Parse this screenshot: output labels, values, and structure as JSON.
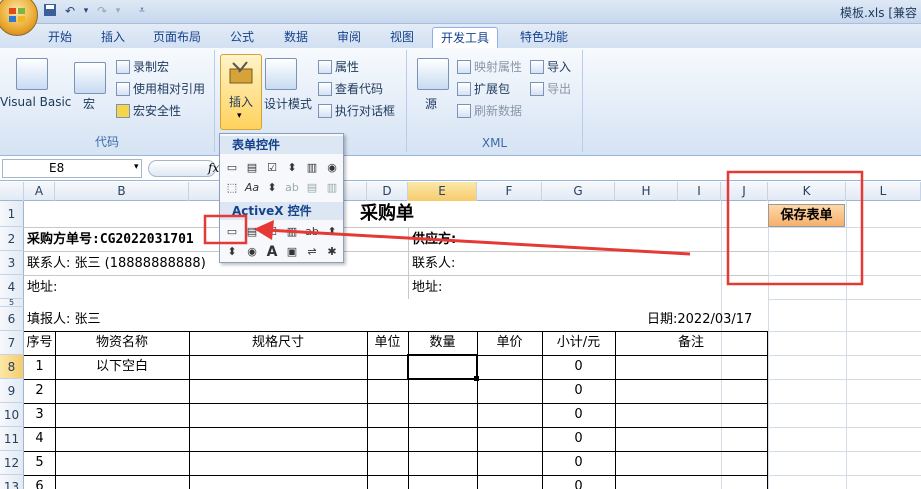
{
  "title_bar": {
    "doc_title": "模板.xls  [兼容"
  },
  "tabs": [
    "开始",
    "插入",
    "页面布局",
    "公式",
    "数据",
    "审阅",
    "视图",
    "开发工具",
    "特色功能"
  ],
  "active_tab": "开发工具",
  "ribbon": {
    "code_group": {
      "label": "代码",
      "visual_basic": "Visual Basic",
      "macro": "宏",
      "record_macro": "录制宏",
      "relative_ref": "使用相对引用",
      "macro_security": "宏安全性"
    },
    "controls_group": {
      "insert": "插入",
      "design_mode": "设计模式",
      "properties": "属性",
      "view_code": "查看代码",
      "run_dialog": "执行对话框"
    },
    "xml_group": {
      "label": "XML",
      "source": "源",
      "map_props": "映射属性",
      "expansion": "扩展包",
      "refresh": "刷新数据",
      "import": "导入",
      "export": "导出"
    }
  },
  "dropdown": {
    "form_controls_title": "表单控件",
    "activex_title": "ActiveX 控件"
  },
  "formula_bar": {
    "name_box": "E8",
    "fx": "fx"
  },
  "columns": [
    "A",
    "B",
    "C",
    "D",
    "E",
    "F",
    "G",
    "H",
    "I",
    "J",
    "K",
    "L"
  ],
  "rows": [
    "1",
    "2",
    "3",
    "4",
    "5",
    "6",
    "7",
    "8",
    "9",
    "10",
    "11",
    "12",
    "13"
  ],
  "sheet": {
    "title": "采购单",
    "order_no": "采购方单号:CG2022031701",
    "supplier": "供应方:",
    "contact_left": "联系人: 张三 (18888888888)",
    "contact_right": "联系人:",
    "address_left": "地址:",
    "address_right": "地址:",
    "filler": "填报人: 张三",
    "date": "日期:2022/03/17",
    "headers": [
      "序号",
      "物资名称",
      "规格尺寸",
      "单位",
      "数量",
      "单价",
      "小计/元",
      "备注"
    ],
    "rows": [
      {
        "no": "1",
        "name": "以下空白",
        "subtotal": "0"
      },
      {
        "no": "2",
        "name": "",
        "subtotal": "0"
      },
      {
        "no": "3",
        "name": "",
        "subtotal": "0"
      },
      {
        "no": "4",
        "name": "",
        "subtotal": "0"
      },
      {
        "no": "5",
        "name": "",
        "subtotal": "0"
      },
      {
        "no": "6",
        "name": "",
        "subtotal": "0"
      }
    ],
    "save_button": "保存表单"
  },
  "colors": {
    "highlight": "#e53935",
    "save_button": "#f5b06c"
  }
}
